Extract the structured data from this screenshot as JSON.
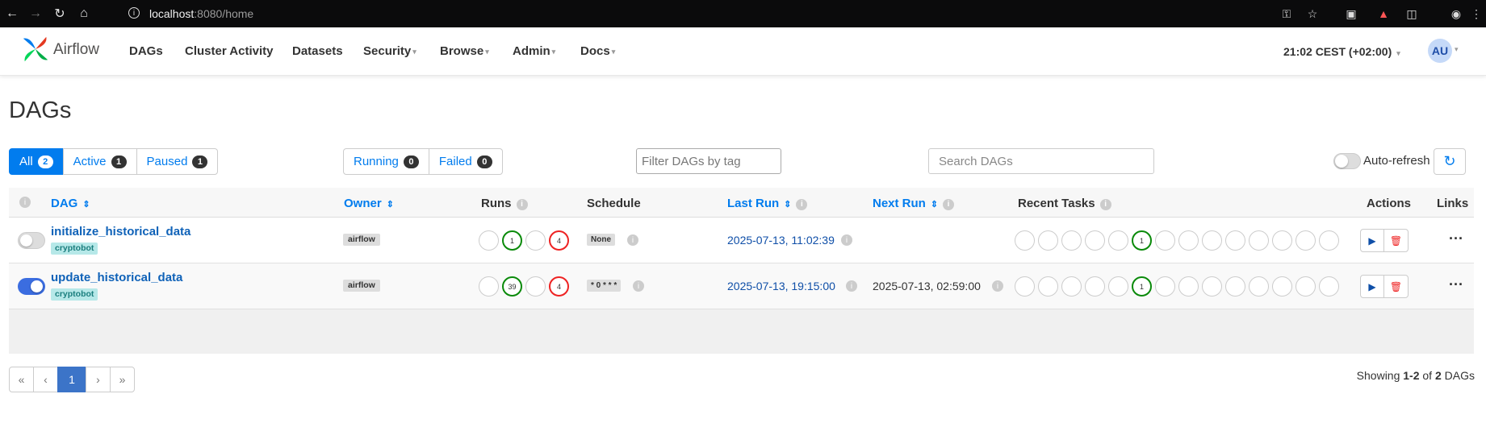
{
  "browser": {
    "url_host": "localhost",
    "url_path": ":8080/home"
  },
  "navbar": {
    "brand": "Airflow",
    "items": [
      {
        "label": "DAGs",
        "caret": false
      },
      {
        "label": "Cluster Activity",
        "caret": false
      },
      {
        "label": "Datasets",
        "caret": false
      },
      {
        "label": "Security",
        "caret": true
      },
      {
        "label": "Browse",
        "caret": true
      },
      {
        "label": "Admin",
        "caret": true
      },
      {
        "label": "Docs",
        "caret": true
      }
    ],
    "clock": "21:02 CEST (+02:00)",
    "avatar": "AU"
  },
  "page": {
    "title": "DAGs"
  },
  "status_filter": {
    "all_label": "All",
    "all_count": "2",
    "active_label": "Active",
    "active_count": "1",
    "paused_label": "Paused",
    "paused_count": "1"
  },
  "run_filter": {
    "running_label": "Running",
    "running_count": "0",
    "failed_label": "Failed",
    "failed_count": "0"
  },
  "tag_filter": {
    "placeholder": "Filter DAGs by tag"
  },
  "search": {
    "placeholder": "Search DAGs"
  },
  "auto_refresh": {
    "label": "Auto-refresh",
    "enabled": false
  },
  "table": {
    "headers": {
      "dag": "DAG",
      "owner": "Owner",
      "runs": "Runs",
      "schedule": "Schedule",
      "last_run": "Last Run",
      "next_run": "Next Run",
      "recent_tasks": "Recent Tasks",
      "actions": "Actions",
      "links": "Links"
    },
    "rows": [
      {
        "dag_id": "initialize_historical_data",
        "tag": "cryptobot",
        "enabled": false,
        "owner": "airflow",
        "runs": [
          "",
          "1",
          "",
          "4"
        ],
        "schedule": "None",
        "last_run": "2025-07-13, 11:02:39",
        "next_run": "",
        "recent_task_success": "1"
      },
      {
        "dag_id": "update_historical_data",
        "tag": "cryptobot",
        "enabled": true,
        "owner": "airflow",
        "runs": [
          "",
          "39",
          "",
          "4"
        ],
        "schedule": "* 0 * * *",
        "last_run": "2025-07-13, 19:15:00",
        "next_run": "2025-07-13, 02:59:00",
        "recent_task_success": "1"
      }
    ]
  },
  "pagination": {
    "first": "«",
    "prev": "‹",
    "current": "1",
    "next": "›",
    "last": "»"
  },
  "showing": {
    "prefix": "Showing ",
    "range": "1-2",
    "middle": " of ",
    "total": "2",
    "suffix": " DAGs"
  },
  "colors": {
    "accent": "#017cee",
    "success": "#0a8a0a",
    "failed": "#ee2222",
    "toggle_on": "#3b6de0"
  }
}
